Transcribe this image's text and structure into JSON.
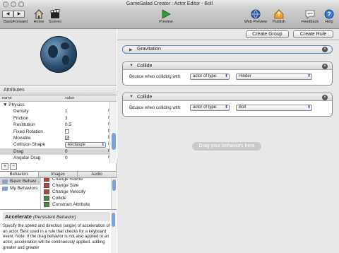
{
  "window": {
    "title": "GameSalad Creator : Actor Editor - Boll"
  },
  "toolbar": {
    "back_forward": "Back/Forward",
    "home": "Home",
    "scenes": "Scenes",
    "preview": "Preview",
    "web_preview": "Web Preview",
    "publish": "Publish",
    "feedback": "Feedback",
    "help": "Help"
  },
  "attributes": {
    "title": "Attributes",
    "col_name": "name",
    "col_value": "value",
    "rows": [
      {
        "name": "Physics",
        "value": "",
        "type": "",
        "kind": "group"
      },
      {
        "name": "Density",
        "value": "1",
        "type": "r",
        "kind": "text"
      },
      {
        "name": "Friction",
        "value": "3",
        "type": "r",
        "kind": "text"
      },
      {
        "name": "Restitution",
        "value": "0,5",
        "type": "r",
        "kind": "text"
      },
      {
        "name": "Fixed Rotation",
        "value": "",
        "type": "b",
        "kind": "check",
        "checked": false
      },
      {
        "name": "Movable",
        "value": "",
        "type": "b",
        "kind": "check",
        "checked": true
      },
      {
        "name": "Collision Shape",
        "value": "Rectangle",
        "type": "i",
        "kind": "select"
      },
      {
        "name": "Drag",
        "value": "0",
        "type": "r",
        "kind": "text",
        "highlight": true
      },
      {
        "name": "Angular Drag",
        "value": "0",
        "type": "r",
        "kind": "text"
      }
    ],
    "add": "+",
    "remove": "−"
  },
  "library": {
    "tabs": [
      "Behaviors",
      "Images",
      "Audio"
    ],
    "categories": [
      "Basic Behavi...",
      "My Behaviors"
    ],
    "behaviors": [
      {
        "label": "Change Scene",
        "color": "#c43c3c"
      },
      {
        "label": "Change Size",
        "color": "#c43c3c"
      },
      {
        "label": "Change Velocity",
        "color": "#c43c3c"
      },
      {
        "label": "Collide",
        "color": "#3c8f3c"
      },
      {
        "label": "Constrain Attribute",
        "color": "#3c8f3c"
      }
    ]
  },
  "description": {
    "name": "Accelerate",
    "kind": "(Persistent Behavior)",
    "text": "Specify the speed and direction (angle) of acceleration of an actor. Best used in a rule that checks for a keyboard event. Note: If the drag behavior is not also applied to an actor, acceleration will be continuously applied, adding greater and greater"
  },
  "editor": {
    "create_group": "Create Group",
    "create_rule": "Create Rule",
    "gravitation": "Gravitation",
    "collide_blocks": [
      {
        "title": "Collide",
        "label": "Bounce when colliding with:",
        "target_type": "actor of type:",
        "target": "Hinder"
      },
      {
        "title": "Collide",
        "label": "Bounce when colliding with:",
        "target_type": "actor of type:",
        "target": "Boll"
      }
    ],
    "drag_hint": "Drag your behaviors here"
  }
}
